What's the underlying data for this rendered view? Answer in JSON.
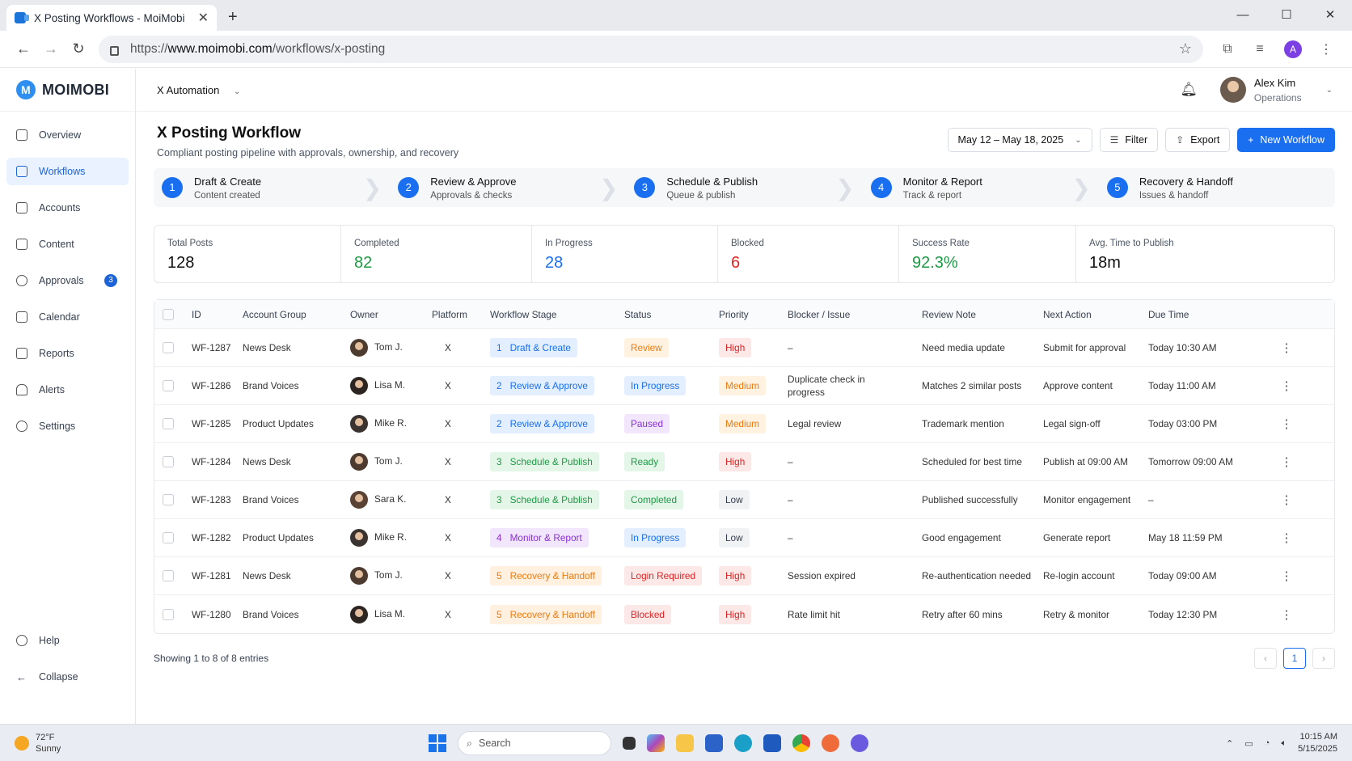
{
  "browser": {
    "tab_title": "X Posting Workflows - MoiMobi",
    "url_prefix": "https://",
    "url_host": "www.moimobi.com",
    "url_path": "/workflows/x-posting",
    "profile_initial": "A"
  },
  "app": {
    "logo_text": "MOIMOBI",
    "logo_letter": "M",
    "workspace": "X Automation",
    "user_name": "Alex Kim",
    "user_role": "Operations"
  },
  "sidebar": {
    "items": [
      {
        "label": "Overview",
        "icon": "home-icon"
      },
      {
        "label": "Workflows",
        "icon": "workflow-icon"
      },
      {
        "label": "Accounts",
        "icon": "users-icon"
      },
      {
        "label": "Content",
        "icon": "document-icon"
      },
      {
        "label": "Approvals",
        "icon": "check-circle-icon",
        "badge": "3"
      },
      {
        "label": "Calendar",
        "icon": "calendar-icon"
      },
      {
        "label": "Reports",
        "icon": "bar-chart-icon"
      },
      {
        "label": "Alerts",
        "icon": "bell-icon"
      },
      {
        "label": "Settings",
        "icon": "gear-icon"
      }
    ],
    "help": "Help",
    "collapse": "Collapse"
  },
  "page": {
    "title": "X Posting Workflow",
    "subtitle": "Compliant posting pipeline with approvals, ownership, and recovery",
    "date_range": "May 12 – May 18, 2025",
    "filter": "Filter",
    "export": "Export",
    "new_workflow": "New Workflow"
  },
  "steps": [
    {
      "num": "1",
      "title": "Draft & Create",
      "sub": "Content created"
    },
    {
      "num": "2",
      "title": "Review & Approve",
      "sub": "Approvals & checks"
    },
    {
      "num": "3",
      "title": "Schedule & Publish",
      "sub": "Queue & publish"
    },
    {
      "num": "4",
      "title": "Monitor & Report",
      "sub": "Track & report"
    },
    {
      "num": "5",
      "title": "Recovery & Handoff",
      "sub": "Issues & handoff"
    }
  ],
  "stats": [
    {
      "label": "Total Posts",
      "value": "128",
      "color": "#111111"
    },
    {
      "label": "Completed",
      "value": "82",
      "color": "#1e9a45"
    },
    {
      "label": "In Progress",
      "value": "28",
      "color": "#1a6ff0"
    },
    {
      "label": "Blocked",
      "value": "6",
      "color": "#e02424"
    },
    {
      "label": "Success Rate",
      "value": "92.3%",
      "color": "#1e9a45"
    },
    {
      "label": "Avg. Time to Publish",
      "value": "18m",
      "color": "#111111"
    }
  ],
  "table": {
    "headers": {
      "id": "ID",
      "account": "Account Group",
      "owner": "Owner",
      "platform": "Platform",
      "stage": "Workflow Stage",
      "status": "Status",
      "priority": "Priority",
      "blocker": "Blocker / Issue",
      "note": "Review Note",
      "next": "Next Action",
      "due": "Due Time"
    },
    "rows": [
      {
        "id": "WF-1287",
        "account": "News Desk",
        "owner": "Tom J.",
        "platform": "X",
        "stage_num": "1",
        "stage": "Draft & Create",
        "status": "Review",
        "priority": "High",
        "blocker": "–",
        "note": "Need media update",
        "next": "Submit for approval",
        "due": "Today 10:30 AM"
      },
      {
        "id": "WF-1286",
        "account": "Brand Voices",
        "owner": "Lisa M.",
        "platform": "X",
        "stage_num": "2",
        "stage": "Review & Approve",
        "status": "In Progress",
        "priority": "Medium",
        "blocker": "Duplicate check in progress",
        "note": "Matches 2 similar posts",
        "next": "Approve content",
        "due": "Today 11:00 AM"
      },
      {
        "id": "WF-1285",
        "account": "Product Updates",
        "owner": "Mike R.",
        "platform": "X",
        "stage_num": "2",
        "stage": "Review & Approve",
        "status": "Paused",
        "priority": "Medium",
        "blocker": "Legal review",
        "note": "Trademark mention",
        "next": "Legal sign-off",
        "due": "Today 03:00 PM"
      },
      {
        "id": "WF-1284",
        "account": "News Desk",
        "owner": "Tom J.",
        "platform": "X",
        "stage_num": "3",
        "stage": "Schedule & Publish",
        "status": "Ready",
        "priority": "High",
        "blocker": "–",
        "note": "Scheduled for best time",
        "next": "Publish at 09:00 AM",
        "due": "Tomorrow 09:00 AM"
      },
      {
        "id": "WF-1283",
        "account": "Brand Voices",
        "owner": "Sara K.",
        "platform": "X",
        "stage_num": "3",
        "stage": "Schedule & Publish",
        "status": "Completed",
        "priority": "Low",
        "blocker": "–",
        "note": "Published successfully",
        "next": "Monitor engagement",
        "due": "–"
      },
      {
        "id": "WF-1282",
        "account": "Product Updates",
        "owner": "Mike R.",
        "platform": "X",
        "stage_num": "4",
        "stage": "Monitor & Report",
        "status": "In Progress",
        "priority": "Low",
        "blocker": "–",
        "note": "Good engagement",
        "next": "Generate report",
        "due": "May 18 11:59 PM"
      },
      {
        "id": "WF-1281",
        "account": "News Desk",
        "owner": "Tom J.",
        "platform": "X",
        "stage_num": "5",
        "stage": "Recovery & Handoff",
        "status": "Login Required",
        "priority": "High",
        "blocker": "Session expired",
        "note": "Re-authentication needed",
        "next": "Re-login account",
        "due": "Today 09:00 AM"
      },
      {
        "id": "WF-1280",
        "account": "Brand Voices",
        "owner": "Lisa M.",
        "platform": "X",
        "stage_num": "5",
        "stage": "Recovery & Handoff",
        "status": "Blocked",
        "priority": "High",
        "blocker": "Rate limit hit",
        "note": "Retry after 60 mins",
        "next": "Retry & monitor",
        "due": "Today 12:30 PM"
      }
    ],
    "footer": "Showing 1 to 8 of 8 entries",
    "page": "1"
  },
  "colors": {
    "stage": {
      "1": {
        "bg": "#e3efff",
        "fg": "#1a6ff0"
      },
      "2": {
        "bg": "#e3efff",
        "fg": "#1a6ff0"
      },
      "3": {
        "bg": "#e4f6e8",
        "fg": "#1e9a45"
      },
      "4": {
        "bg": "#f1e6fb",
        "fg": "#8a2fd6"
      },
      "5": {
        "bg": "#fff0e0",
        "fg": "#ee7b10"
      }
    },
    "status": {
      "Review": {
        "bg": "#fff2e0",
        "fg": "#ee7b10"
      },
      "In Progress": {
        "bg": "#e3efff",
        "fg": "#1a6ff0"
      },
      "Paused": {
        "bg": "#f1e6fb",
        "fg": "#8a2fd6"
      },
      "Ready": {
        "bg": "#e4f6e8",
        "fg": "#1e9a45"
      },
      "Completed": {
        "bg": "#e4f6e8",
        "fg": "#1e9a45"
      },
      "Login Required": {
        "bg": "#fde8e8",
        "fg": "#e02424"
      },
      "Blocked": {
        "bg": "#fde8e8",
        "fg": "#e02424"
      }
    },
    "priority": {
      "High": {
        "bg": "#fde8e8",
        "fg": "#e02424"
      },
      "Medium": {
        "bg": "#fff2e0",
        "fg": "#ee7b10"
      },
      "Low": {
        "bg": "#f1f2f4",
        "fg": "#374151"
      }
    }
  },
  "taskbar": {
    "temp": "72°F",
    "condition": "Sunny",
    "search": "Search",
    "time": "10:15 AM",
    "date": "5/15/2025"
  }
}
